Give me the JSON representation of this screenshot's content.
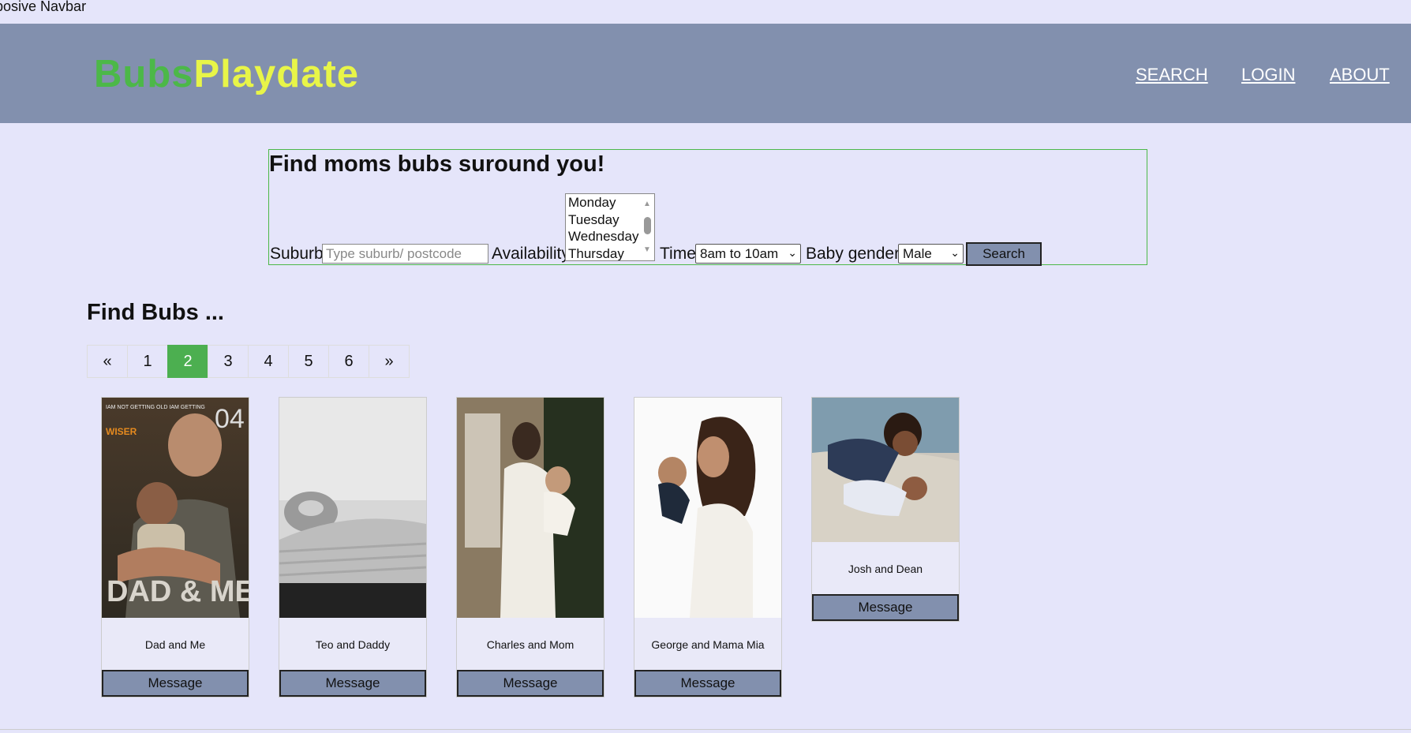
{
  "browser_title": "posive Navbar",
  "navbar": {
    "brand_part1": "Bubs",
    "brand_part2": "Playdate",
    "links": [
      "SEARCH",
      "LOGIN",
      "ABOUT"
    ]
  },
  "search_form": {
    "heading": "Find moms bubs suround you!",
    "suburb_label": "Suburb",
    "suburb_placeholder": "Type suburb/ postcode",
    "availability_label": "Availability",
    "availability_options": [
      "Monday",
      "Tuesday",
      "Wednesday",
      "Thursday"
    ],
    "time_label": "Time",
    "time_selected": "8am to 10am",
    "gender_label": "Baby gender:",
    "gender_selected": "Male",
    "search_button": "Search"
  },
  "results": {
    "heading": "Find Bubs ...",
    "pagination": [
      "«",
      "1",
      "2",
      "3",
      "4",
      "5",
      "6",
      "»"
    ],
    "active_page": "2",
    "cards": [
      {
        "name": "Dad and Me",
        "button": "Message",
        "poster_small": "IAM NOT GETTING OLD IAM GETTING",
        "poster_accent": "WISER",
        "poster_number": "04",
        "poster_big": "DAD & ME!"
      },
      {
        "name": "Teo and Daddy",
        "button": "Message"
      },
      {
        "name": "Charles and Mom",
        "button": "Message"
      },
      {
        "name": "George and Mama Mia",
        "button": "Message"
      },
      {
        "name": "Josh and Dean",
        "button": "Message"
      }
    ]
  },
  "colors": {
    "background": "#e5e5fa",
    "navbar": "#8290ae",
    "brand_green": "#4cb848",
    "brand_yellow": "#e8f548",
    "active_page": "#4caf50"
  }
}
